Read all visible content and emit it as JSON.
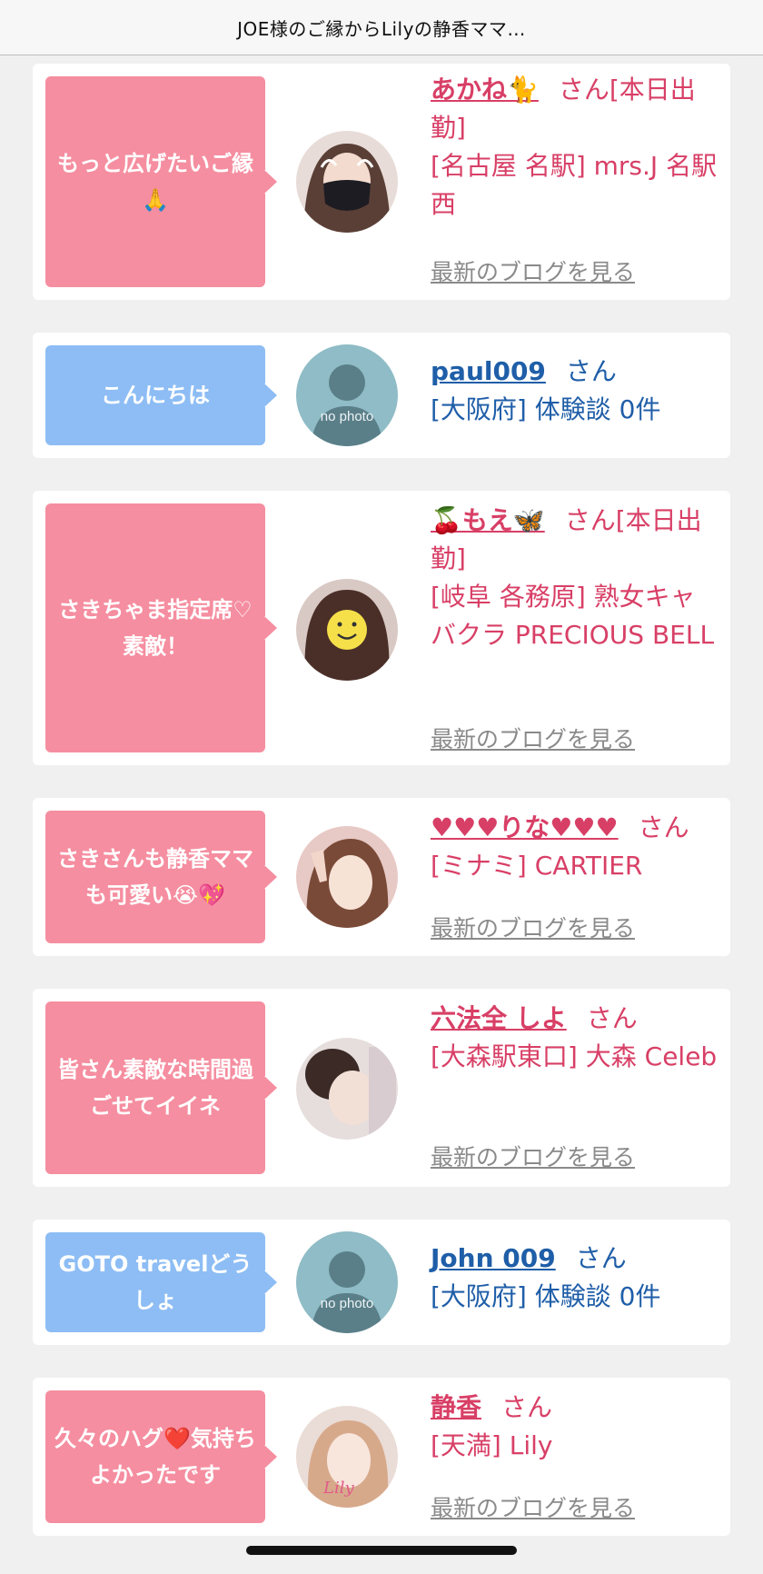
{
  "header": {
    "title": "JOE様のご縁からLilyの静香ママ…"
  },
  "cards": [
    {
      "message": "もっと広げたいご縁🙏",
      "name": "あかね🐈",
      "san_suffix": "さん[本日出勤]",
      "location": "[名古屋 名駅] mrs.J 名駅西",
      "blog_link": "最新のブログを見る",
      "avatar": "woman-mask-avatar"
    },
    {
      "message": "こんにちは",
      "name": "paul009",
      "san_suffix": "さん",
      "location": "[大阪府] 体験談 0件",
      "avatar": "no-photo-avatar",
      "avatar_text": "no photo"
    },
    {
      "message": "さきちゃま指定席♡素敵！",
      "name": "🍒もえ🦋",
      "san_suffix": "さん[本日出勤]",
      "location": "[岐阜 各務原] 熟女キャバクラ PRECIOUS BELL",
      "blog_link": "最新のブログを見る",
      "avatar": "smiley-face-avatar"
    },
    {
      "message": "さきさんも静香ママも可愛い😭💖",
      "name": "♥♥♥りな♥♥♥",
      "san_suffix": "さん",
      "location": "[ミナミ] CARTIER",
      "blog_link": "最新のブログを見る",
      "avatar": "woman-peace-avatar"
    },
    {
      "message": "皆さん素敵な時間過ごせてイイネ",
      "name": "六法全 しよ",
      "san_suffix": "さん",
      "location": "[大森駅東口] 大森 Celeb",
      "blog_link": "最新のブログを見る",
      "avatar": "woman-updo-avatar"
    },
    {
      "message": "GOTO travelどうしょ",
      "name": "John 009",
      "san_suffix": "さん",
      "location": "[大阪府] 体験談 0件",
      "avatar": "no-photo-avatar",
      "avatar_text": "no photo"
    },
    {
      "message": "久々のハグ❤️気持ちよかったです",
      "name": "静香",
      "san_suffix": "さん",
      "location": "[天満] Lily",
      "blog_link": "最新のブログを見る",
      "avatar": "woman-lily-avatar",
      "avatar_text": "Lily"
    }
  ],
  "colors": {
    "pink_bubble": "#f58ea0",
    "blue_bubble": "#8dbdf4",
    "pink_text": "#d83f66",
    "blue_text": "#1f5ea8"
  }
}
